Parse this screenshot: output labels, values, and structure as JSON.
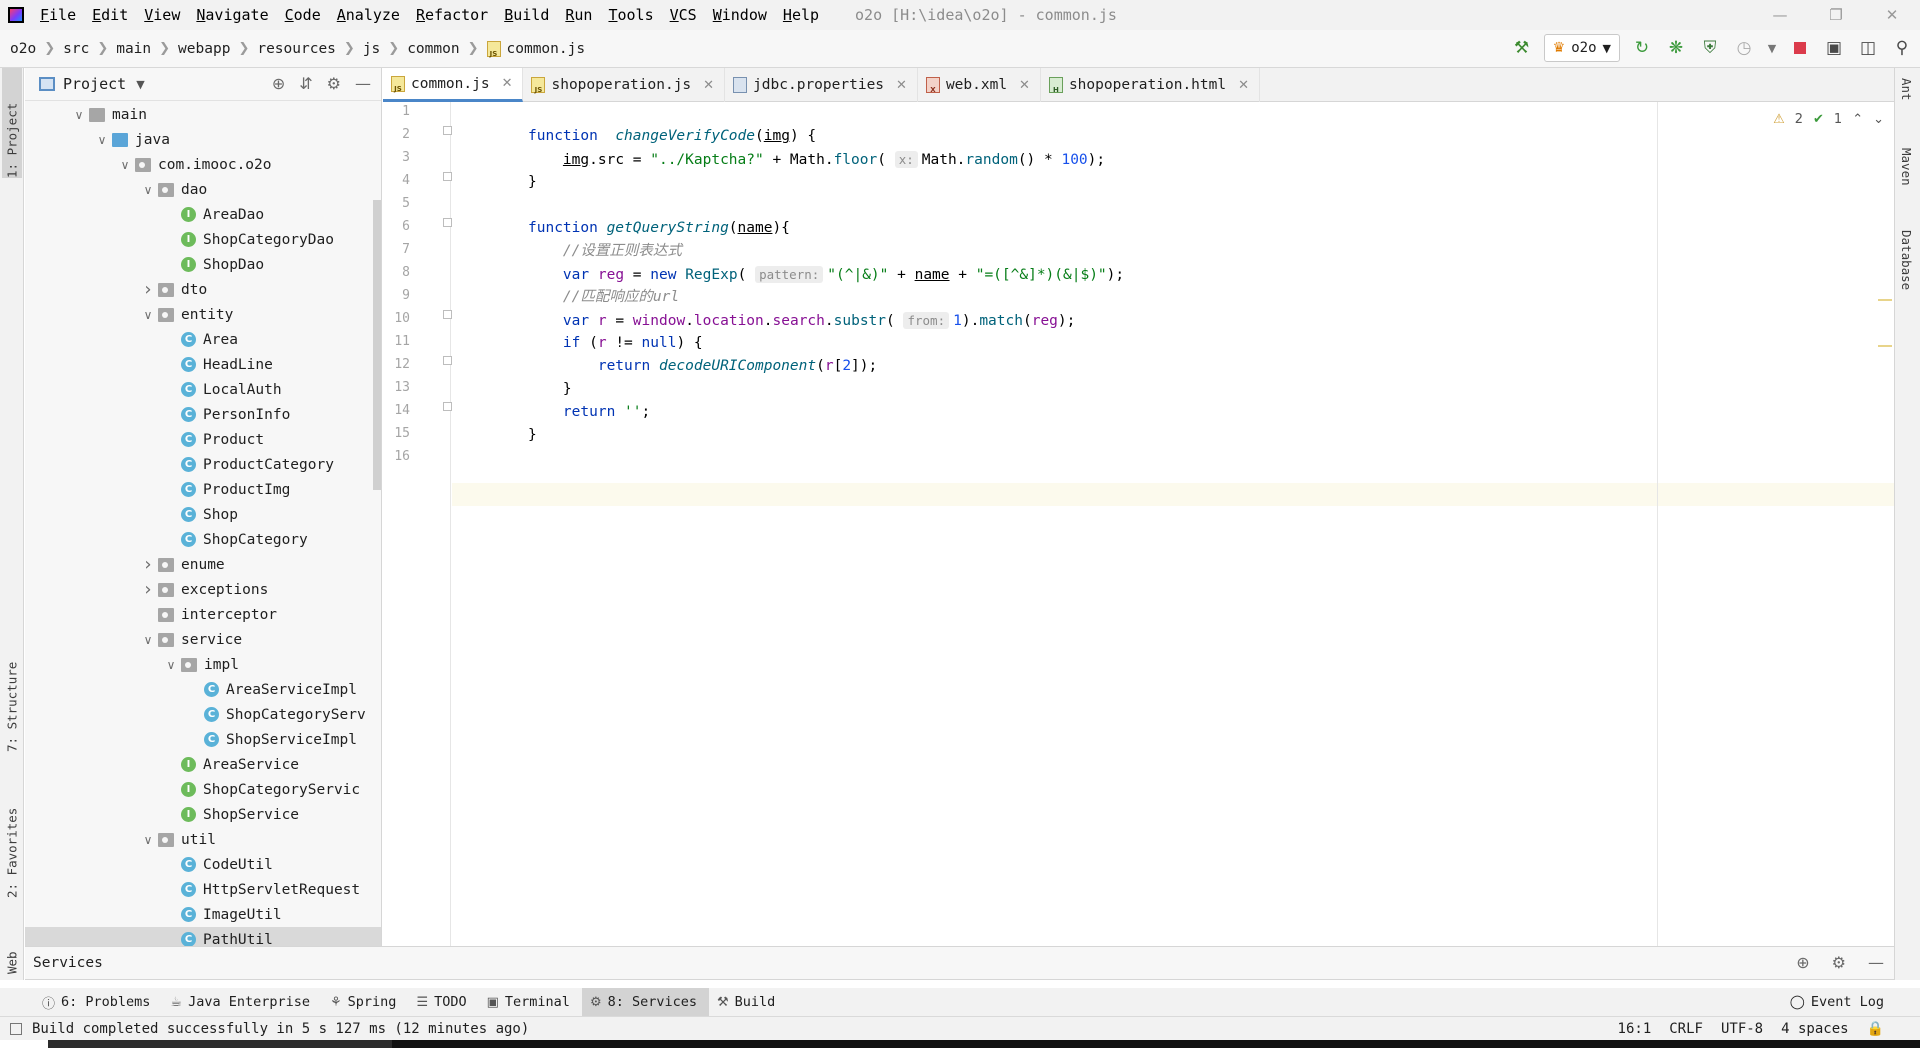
{
  "menubar": {
    "items": [
      "File",
      "Edit",
      "View",
      "Navigate",
      "Code",
      "Analyze",
      "Refactor",
      "Build",
      "Run",
      "Tools",
      "VCS",
      "Window",
      "Help"
    ],
    "window_title": "o2o [H:\\idea\\o2o] - common.js"
  },
  "breadcrumb": [
    "o2o",
    "src",
    "main",
    "webapp",
    "resources",
    "js",
    "common",
    "common.js"
  ],
  "toolbar": {
    "run_config": "o2o"
  },
  "left_strip": {
    "project": "1: Project",
    "structure": "7: Structure",
    "favorites": "2: Favorites",
    "web": "Web"
  },
  "right_strip": {
    "ant": "Ant",
    "maven": "Maven",
    "database": "Database"
  },
  "project_panel": {
    "title": "Project",
    "tree": [
      {
        "label": "main",
        "icon": "folder",
        "depth": 0,
        "expanded": true
      },
      {
        "label": "java",
        "icon": "java",
        "depth": 1,
        "expanded": true
      },
      {
        "label": "com.imooc.o2o",
        "icon": "package",
        "depth": 2,
        "expanded": true
      },
      {
        "label": "dao",
        "icon": "package",
        "depth": 3,
        "expanded": true
      },
      {
        "label": "AreaDao",
        "icon": "interface",
        "depth": 4
      },
      {
        "label": "ShopCategoryDao",
        "icon": "interface",
        "depth": 4
      },
      {
        "label": "ShopDao",
        "icon": "interface",
        "depth": 4
      },
      {
        "label": "dto",
        "icon": "package",
        "depth": 3,
        "expanded": false
      },
      {
        "label": "entity",
        "icon": "package",
        "depth": 3,
        "expanded": true
      },
      {
        "label": "Area",
        "icon": "class",
        "depth": 4
      },
      {
        "label": "HeadLine",
        "icon": "class",
        "depth": 4
      },
      {
        "label": "LocalAuth",
        "icon": "class",
        "depth": 4
      },
      {
        "label": "PersonInfo",
        "icon": "class",
        "depth": 4
      },
      {
        "label": "Product",
        "icon": "class",
        "depth": 4
      },
      {
        "label": "ProductCategory",
        "icon": "class",
        "depth": 4
      },
      {
        "label": "ProductImg",
        "icon": "class",
        "depth": 4
      },
      {
        "label": "Shop",
        "icon": "class",
        "depth": 4
      },
      {
        "label": "ShopCategory",
        "icon": "class",
        "depth": 4
      },
      {
        "label": "enume",
        "icon": "package",
        "depth": 3,
        "expanded": false
      },
      {
        "label": "exceptions",
        "icon": "package",
        "depth": 3,
        "expanded": false
      },
      {
        "label": "interceptor",
        "icon": "package",
        "depth": 3
      },
      {
        "label": "service",
        "icon": "package",
        "depth": 3,
        "expanded": true
      },
      {
        "label": "impl",
        "icon": "package",
        "depth": 4,
        "expanded": true
      },
      {
        "label": "AreaServiceImpl",
        "icon": "class",
        "depth": 5
      },
      {
        "label": "ShopCategoryServ",
        "icon": "class",
        "depth": 5
      },
      {
        "label": "ShopServiceImpl",
        "icon": "class",
        "depth": 5
      },
      {
        "label": "AreaService",
        "icon": "interface",
        "depth": 4
      },
      {
        "label": "ShopCategoryServic",
        "icon": "interface",
        "depth": 4
      },
      {
        "label": "ShopService",
        "icon": "interface",
        "depth": 4
      },
      {
        "label": "util",
        "icon": "package",
        "depth": 3,
        "expanded": true
      },
      {
        "label": "CodeUtil",
        "icon": "class",
        "depth": 4
      },
      {
        "label": "HttpServletRequest",
        "icon": "class",
        "depth": 4
      },
      {
        "label": "ImageUtil",
        "icon": "class",
        "depth": 4
      },
      {
        "label": "PathUtil",
        "icon": "class",
        "depth": 4,
        "selected": true
      }
    ]
  },
  "editor": {
    "tabs": [
      {
        "label": "common.js",
        "icon": "js",
        "active": true
      },
      {
        "label": "shopoperation.js",
        "icon": "js"
      },
      {
        "label": "jdbc.properties",
        "icon": "properties"
      },
      {
        "label": "web.xml",
        "icon": "xml"
      },
      {
        "label": "shopoperation.html",
        "icon": "html"
      }
    ],
    "inspection": {
      "warnings": "2",
      "ok": "1"
    },
    "line_numbers": [
      "1",
      "2",
      "3",
      "4",
      "5",
      "6",
      "7",
      "8",
      "9",
      "10",
      "11",
      "12",
      "13",
      "14",
      "15",
      "16"
    ],
    "code": {
      "l2_kw": "function",
      "l2_fn": "changeVerifyCode",
      "l2_param": "img",
      "l2_rest": ") {",
      "l3_param": "img",
      "l3_a": ".src = ",
      "l3_str": "\"../Kaptcha?\"",
      "l3_b": " + Math.",
      "l3_floor": "floor",
      "l3_hint": "x:",
      "l3_c": "Math.",
      "l3_random": "random",
      "l3_d": "() * ",
      "l3_num": "100",
      "l3_e": ");",
      "l4": "}",
      "l6_kw": "function",
      "l6_fn": "getQueryString",
      "l6_param": "name",
      "l6_rest": "){",
      "l7_cmt": "//设置正则表达式",
      "l8_var": "var",
      "l8_reg": "reg",
      "l8_a": " = ",
      "l8_new": "new",
      "l8_regexp": "RegExp",
      "l8_hint": "pattern:",
      "l8_str1": "\"(^|&)\"",
      "l8_b": " + ",
      "l8_name": "name",
      "l8_c": " + ",
      "l8_str2": "\"=([^&]*)(&|$)\"",
      "l8_d": ");",
      "l9_cmt": "//匹配响应的url",
      "l10_var": "var",
      "l10_r": "r",
      "l10_a": " = ",
      "l10_window": "window",
      "l10_b": ".",
      "l10_location": "location",
      "l10_c": ".",
      "l10_search": "search",
      "l10_d": ".",
      "l10_substr": "substr",
      "l10_hint": "from:",
      "l10_num": "1",
      "l10_e": ").",
      "l10_match": "match",
      "l10_f": "(",
      "l10_reg": "reg",
      "l10_g": ");",
      "l11_if": "if",
      "l11_a": " (",
      "l11_r": "r",
      "l11_b": " != ",
      "l11_null": "null",
      "l11_c": ") {",
      "l12_ret": "return",
      "l12_fn": "decodeURIComponent",
      "l12_a": "(",
      "l12_r": "r",
      "l12_b": "[",
      "l12_num": "2",
      "l12_c": "]);",
      "l13": "}",
      "l14_ret": "return",
      "l14_str": "''",
      "l14_a": ";",
      "l15": "}"
    }
  },
  "services": {
    "title": "Services"
  },
  "tool_tabs": [
    {
      "label": "6: Problems",
      "icon": "info"
    },
    {
      "label": "Java Enterprise",
      "icon": "java-ee"
    },
    {
      "label": "Spring",
      "icon": "spring"
    },
    {
      "label": "TODO",
      "icon": "todo"
    },
    {
      "label": "Terminal",
      "icon": "terminal"
    },
    {
      "label": "8: Services",
      "icon": "services",
      "active": true
    },
    {
      "label": "Build",
      "icon": "build"
    }
  ],
  "event_log": "Event Log",
  "status": {
    "message": "Build completed successfully in 5 s 127 ms (12 minutes ago)",
    "position": "16:1",
    "line_sep": "CRLF",
    "encoding": "UTF-8",
    "indent": "4 spaces"
  }
}
